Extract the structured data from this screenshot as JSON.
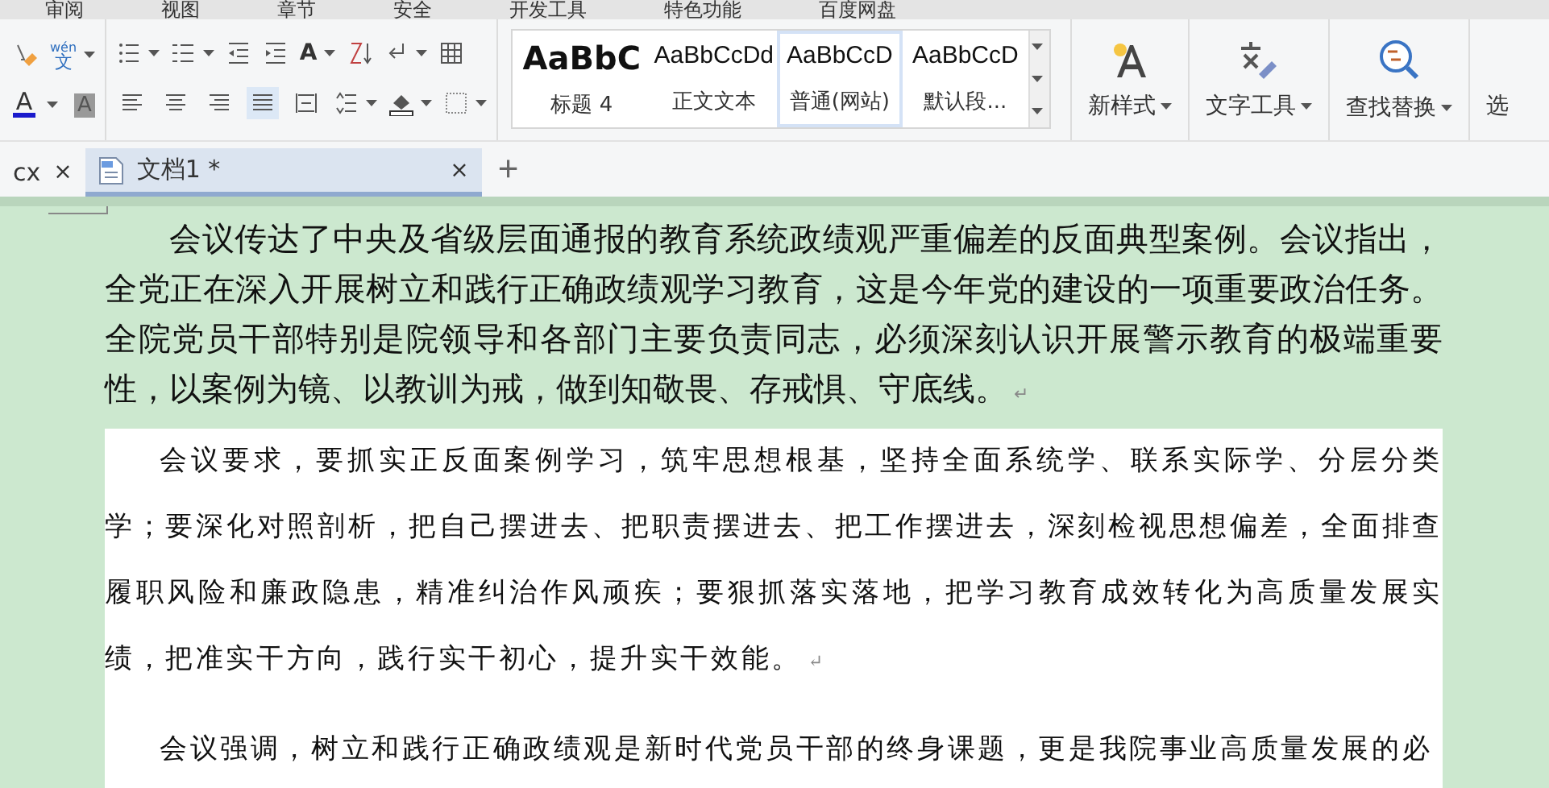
{
  "menu_bar": [
    "审阅",
    "视图",
    "章节",
    "安全",
    "开发工具",
    "特色功能",
    "百度网盘"
  ],
  "font_tools": {
    "pinyin": {
      "top": "wén",
      "bottom": "文"
    },
    "font_color": {
      "glyph": "A",
      "color": "#1a1acc"
    },
    "char_shading": {
      "glyph": "A"
    }
  },
  "paragraph_tools": {
    "font_size_glyph": "A"
  },
  "alignment": [
    {
      "selected": false
    },
    {
      "selected": false
    },
    {
      "selected": false
    },
    {
      "selected": true
    },
    {
      "selected": false
    }
  ],
  "styles": [
    {
      "kind": "heading",
      "preview": "AaBbC",
      "label": "标题 4",
      "selected": false
    },
    {
      "kind": "body",
      "preview": "AaBbCcDd",
      "label": "正文文本",
      "selected": false
    },
    {
      "kind": "body",
      "preview": "AaBbCcD",
      "label": "普通(网站)",
      "selected": true
    },
    {
      "kind": "body",
      "preview": "AaBbCcD",
      "label": "默认段...",
      "selected": false
    }
  ],
  "big_buttons": [
    {
      "kind": "new-style",
      "label": "新样式",
      "dropdown": true
    },
    {
      "kind": "text-tools",
      "label": "文字工具",
      "dropdown": true
    },
    {
      "kind": "find-replace",
      "label": "查找替换",
      "dropdown": true
    },
    {
      "kind": "select",
      "label": "选",
      "dropdown": false
    }
  ],
  "tabs": [
    {
      "label": "cx",
      "selected": false,
      "close": "×"
    },
    {
      "label": "文档1 *",
      "selected": true,
      "close": "×"
    }
  ],
  "new_tab": "+",
  "document": {
    "paragraphs": [
      {
        "kind": "sans",
        "shaded": false,
        "mark": "↵",
        "text": "会议传达了中央及省级层面通报的教育系统政绩观严重偏差的反面典型案例。会议指出，全党正在深入开展树立和践行正确政绩观学习教育，这是今年党的建设的一项重要政治任务。全院党员干部特别是院领导和各部门主要负责同志，必须深刻认识开展警示教育的极端重要性，以案例为镜、以教训为戒，做到知敬畏、存戒惧、守底线。"
      },
      {
        "kind": "serif",
        "shaded": true,
        "mark": "↵",
        "text": "会议要求，要抓实正反面案例学习，筑牢思想根基，坚持全面系统学、联系实际学、分层分类学；要深化对照剖析，把自己摆进去、把职责摆进去、把工作摆进去，深刻检视思想偏差，全面排查履职风险和廉政隐患，精准纠治作风顽疾；要狠抓落实落地，把学习教育成效转化为高质量发展实绩，把准实干方向，践行实干初心，提升实干效能。"
      },
      {
        "kind": "serif",
        "shaded": true,
        "text": "会议强调，树立和践行正确政绩观是新时代党员干部的终身课题，更是我院事业高质量发展的必"
      }
    ]
  }
}
